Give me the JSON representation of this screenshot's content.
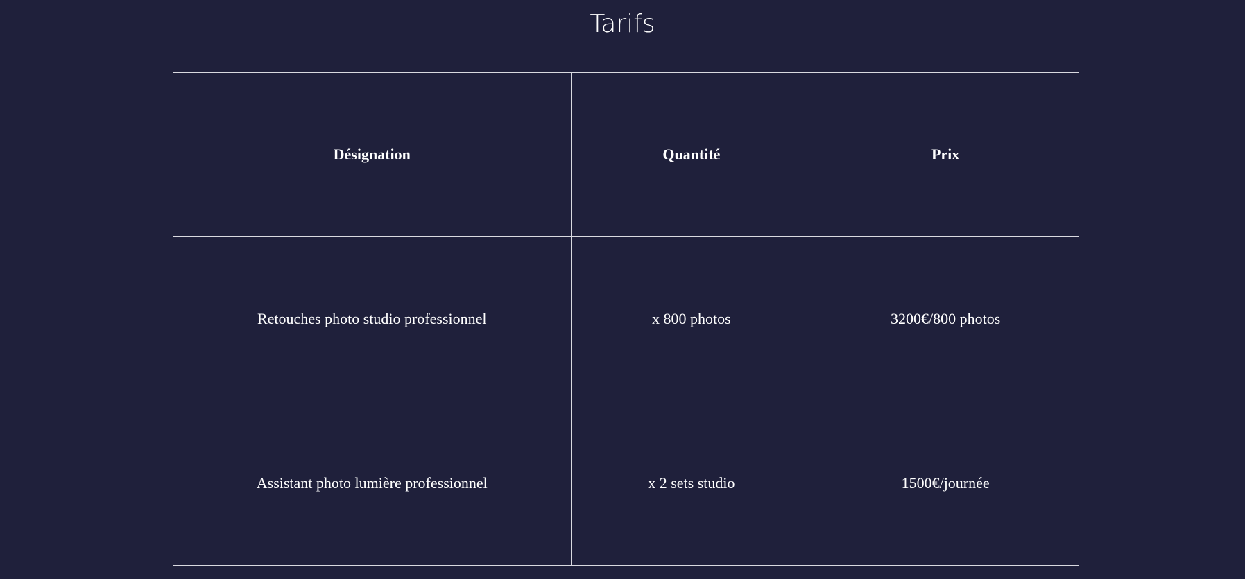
{
  "page": {
    "title": "Tarifs"
  },
  "table": {
    "headers": [
      "Désignation",
      "Quantité",
      "Prix"
    ],
    "rows": [
      {
        "designation": "Retouches photo studio professionnel",
        "quantite": "x 800 photos",
        "prix": "3200€/800 photos"
      },
      {
        "designation": "Assistant photo lumière professionnel",
        "quantite": "x 2 sets studio",
        "prix": "1500€/journée"
      }
    ]
  },
  "colors": {
    "background": "#1f203b",
    "text": "#ffffff",
    "border": "#d9d9e0"
  }
}
